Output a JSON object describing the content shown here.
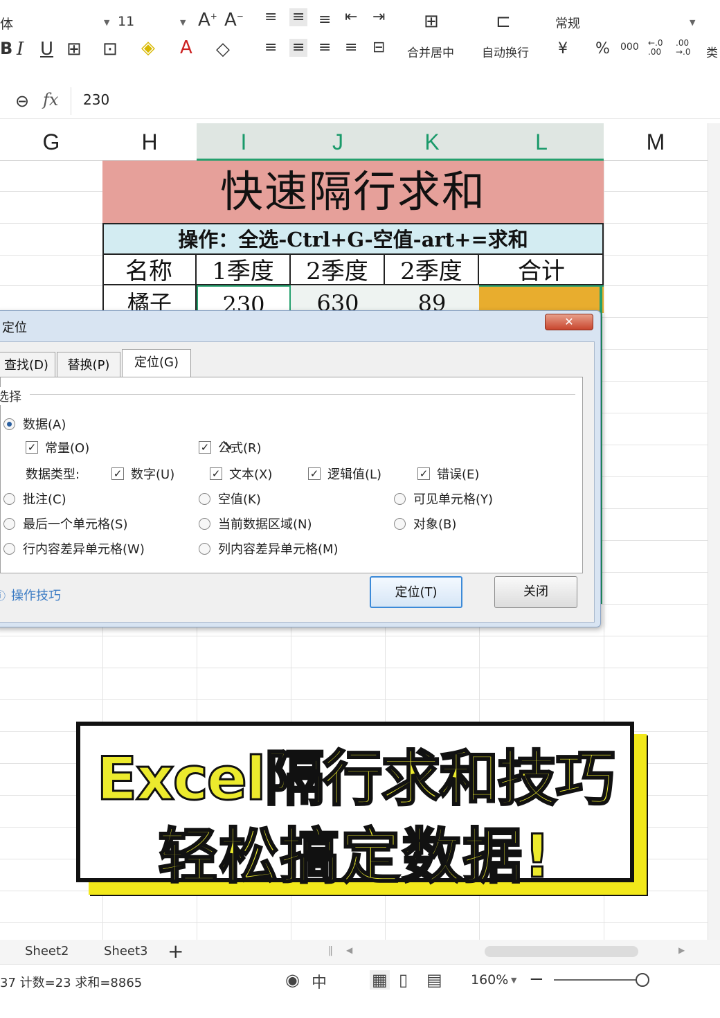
{
  "ribbon": {
    "font_name": "体",
    "font_size": "11",
    "merge_label": "合并居中",
    "wrap_label": "自动换行",
    "number_format": "常规",
    "currency": "¥",
    "percent": "%",
    "thousands": "000",
    "inc_decimal": "←.0 .00",
    "dec_decimal": ".00 →.0",
    "cell_type_partial": "类"
  },
  "formula_bar": {
    "fx": "fx",
    "value": "230"
  },
  "columns": [
    "G",
    "H",
    "I",
    "J",
    "K",
    "L",
    "M"
  ],
  "table": {
    "title": "快速隔行求和",
    "subtitle": "操作：全选-Ctrl+G-空值-art+=求和",
    "headers": [
      "名称",
      "1季度",
      "2季度",
      "2季度",
      "合计"
    ],
    "first_row": [
      "橘子",
      "230",
      "630",
      "89",
      ""
    ]
  },
  "dialog": {
    "title": "定位",
    "close": "✕",
    "tabs": [
      "查找(D)",
      "替换(P)",
      "定位(G)"
    ],
    "group_label": "选择",
    "options": {
      "data": "数据(A)",
      "constants": "常量(O)",
      "formulas": "公式(R)",
      "data_type_label": "数据类型:",
      "numbers": "数字(U)",
      "text": "文本(X)",
      "logicals": "逻辑值(L)",
      "errors": "错误(E)",
      "comments": "批注(C)",
      "blanks": "空值(K)",
      "visible_cells": "可见单元格(Y)",
      "last_cell": "最后一个单元格(S)",
      "current_region": "当前数据区域(N)",
      "objects": "对象(B)",
      "row_diff": "行内容差异单元格(W)",
      "col_diff": "列内容差异单元格(M)"
    },
    "tips": "操作技巧",
    "goto_button": "定位(T)",
    "close_button": "关闭"
  },
  "banner": {
    "line1": "Excel隔行求和技巧",
    "line2": "轻松搞定数据!"
  },
  "sheet_tabs": [
    "Sheet2",
    "Sheet3"
  ],
  "add_sheet": "+",
  "status": {
    "info": "37 计数=23 求和=8865",
    "zoom": "160%"
  },
  "colors": {
    "title_bg": "#e6a09a",
    "subtitle_bg": "#d3ecf2",
    "total_bg": "#e8ad2e",
    "accent": "#25a06e",
    "banner_text": "#ecea2d"
  }
}
